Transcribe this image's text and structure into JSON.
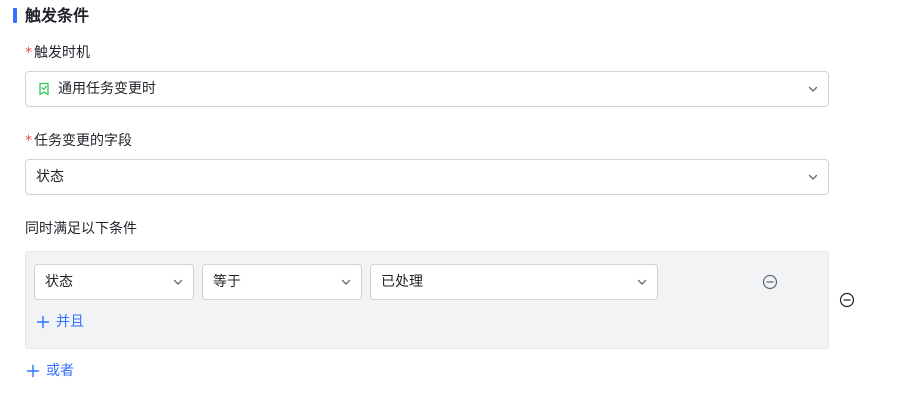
{
  "section": {
    "title": "触发条件"
  },
  "trigger_time": {
    "label": "触发时机",
    "required_mark": "*",
    "value": "通用任务变更时"
  },
  "changed_field": {
    "label": "任务变更的字段",
    "required_mark": "*",
    "value": "状态"
  },
  "conditions": {
    "label": "同时满足以下条件",
    "rule": {
      "field": "状态",
      "operator": "等于",
      "value": "已处理"
    },
    "and_label": "并且",
    "or_label": "或者"
  },
  "colors": {
    "accent": "#3370ff",
    "required": "#f54a45",
    "trigger_icon": "#34c759"
  },
  "icons": {
    "trigger": "bookmark-check-icon",
    "dropdown": "chevron-down-icon",
    "remove": "minus-circle-icon",
    "add": "plus-icon"
  }
}
